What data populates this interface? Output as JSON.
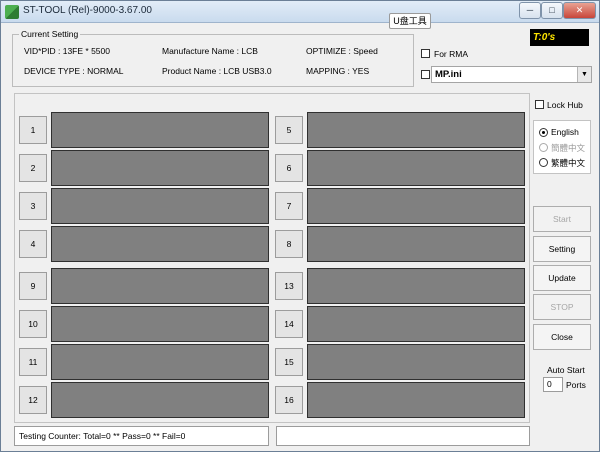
{
  "window": {
    "title": "ST-TOOL (Rel)-9000-3.67.00",
    "minimize_label": "─",
    "maximize_label": "□",
    "close_label": "✕"
  },
  "toolbar": {
    "udisk_label": "U盘工具"
  },
  "timer": {
    "value": "T:0's"
  },
  "current_setting": {
    "legend": "Current Setting",
    "vid_pid": "VID*PID : 13FE * 5500",
    "manufacture_name": "Manufacture Name : LCB",
    "optimize": "OPTIMIZE : Speed",
    "device_type": "DEVICE TYPE : NORMAL",
    "product_name": "Product Name : LCB USB3.0",
    "mapping": "MAPPING : YES"
  },
  "options": {
    "for_rma_label": "For RMA",
    "for_rma_checked": false,
    "mp_checked": false,
    "mp_file": "MP.ini",
    "lock_hub_label": "Lock Hub",
    "lock_hub_checked": false
  },
  "language": {
    "options": [
      {
        "label": "English",
        "selected": true,
        "enabled": true
      },
      {
        "label": "簡體中文",
        "selected": false,
        "enabled": false
      },
      {
        "label": "繁體中文",
        "selected": false,
        "enabled": true
      }
    ]
  },
  "actions": {
    "start_label": "Start",
    "setting_label": "Setting",
    "update_label": "Update",
    "stop_label": "STOP",
    "close_label": "Close"
  },
  "auto_start": {
    "label": "Auto Start",
    "ports_value": "0",
    "ports_label": "Ports"
  },
  "ports": {
    "left": [
      "1",
      "2",
      "3",
      "4",
      "9",
      "10",
      "11",
      "12"
    ],
    "right": [
      "5",
      "6",
      "7",
      "8",
      "13",
      "14",
      "15",
      "16"
    ]
  },
  "status": {
    "testing_counter": "Testing Counter: Total=0 ** Pass=0 ** Fail=0",
    "right_text": ""
  }
}
